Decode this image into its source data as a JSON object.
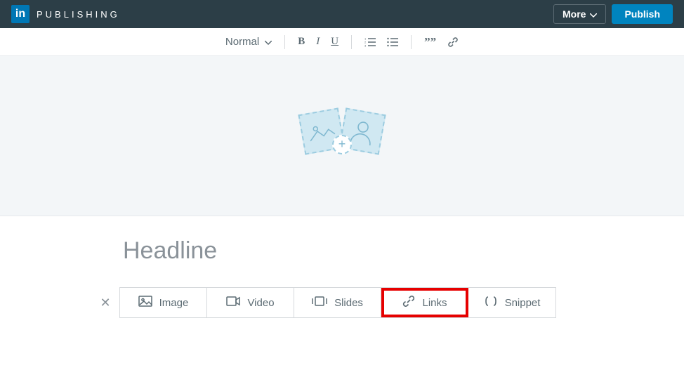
{
  "header": {
    "logo_text": "in",
    "app_title": "PUBLISHING",
    "more_label": "More",
    "publish_label": "Publish"
  },
  "toolbar": {
    "format_label": "Normal",
    "bold": "B",
    "italic": "I",
    "underline": "U",
    "quote": "””"
  },
  "editor": {
    "headline_placeholder": "Headline"
  },
  "insert_bar": {
    "items": [
      {
        "label": "Image"
      },
      {
        "label": "Video"
      },
      {
        "label": "Slides"
      },
      {
        "label": "Links"
      },
      {
        "label": "Snippet"
      }
    ]
  }
}
